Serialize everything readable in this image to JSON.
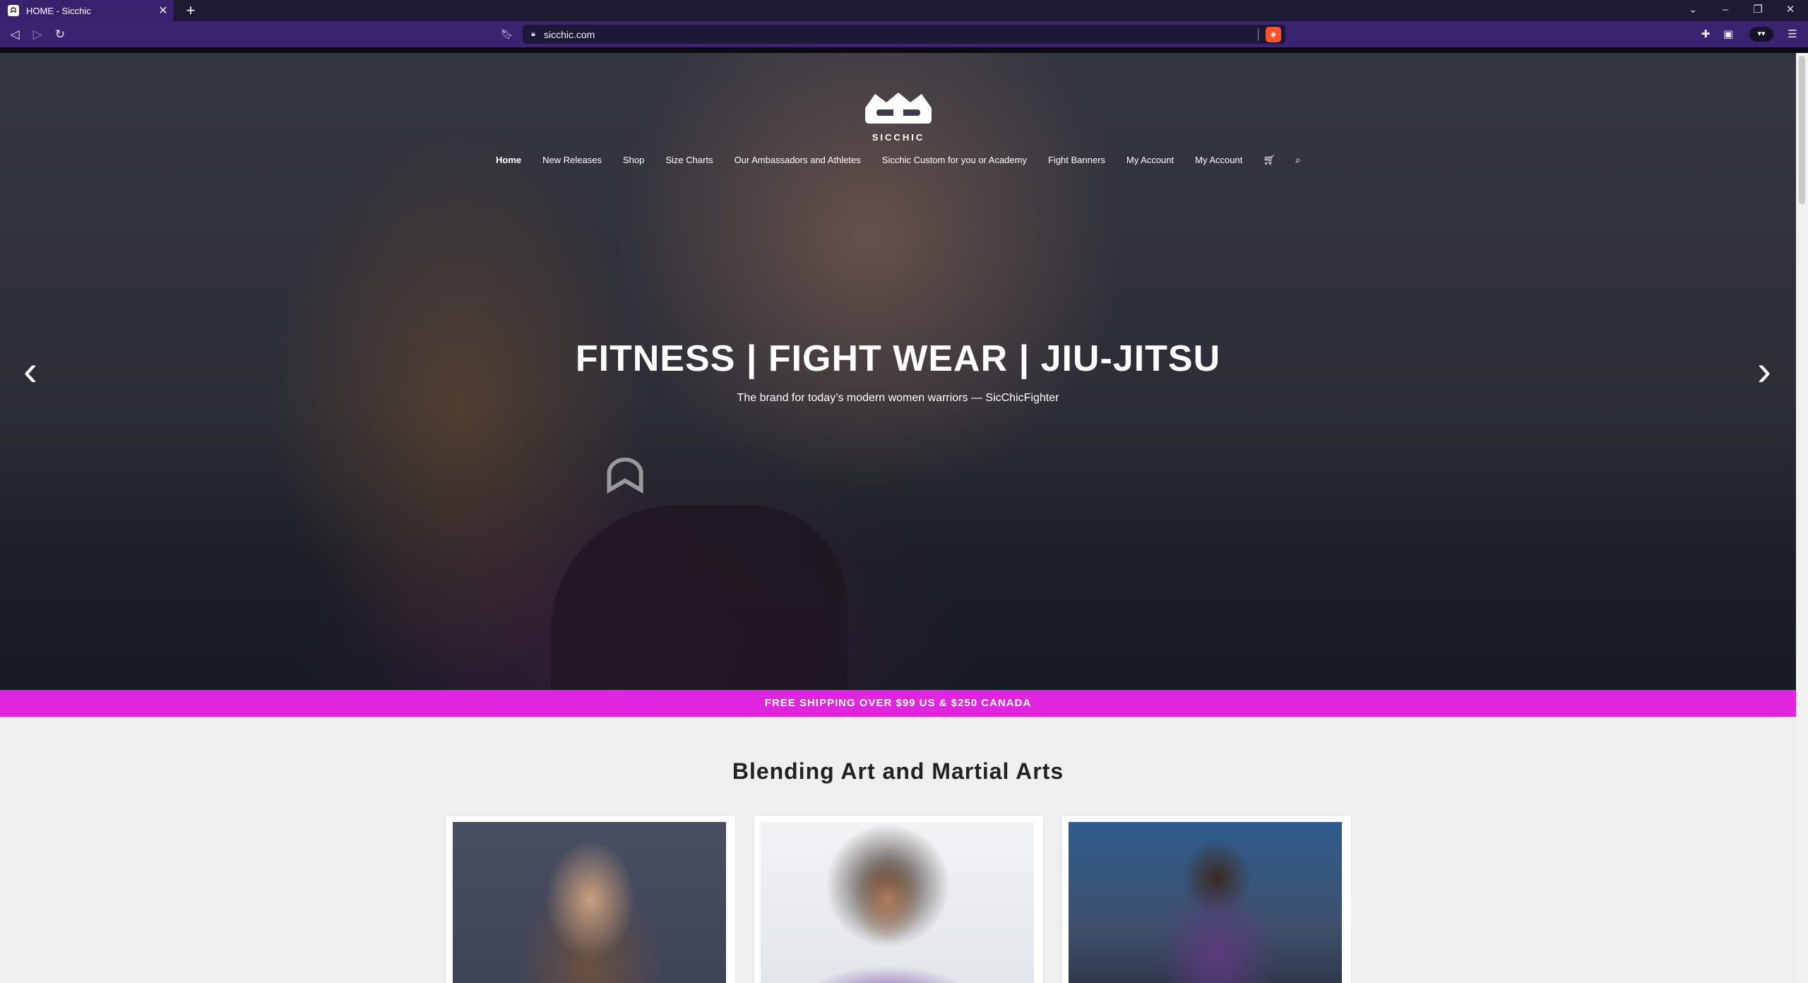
{
  "browser": {
    "tab_title": "HOME - Sicchic",
    "tab_favicon": "sicchic-favicon",
    "url": "sicchic.com"
  },
  "site": {
    "brand_name": "SICCHIC",
    "nav": [
      {
        "label": "Home",
        "active": true
      },
      {
        "label": "New Releases"
      },
      {
        "label": "Shop"
      },
      {
        "label": "Size Charts"
      },
      {
        "label": "Our Ambassadors and Athletes"
      },
      {
        "label": "Sicchic Custom for you or Academy"
      },
      {
        "label": "Fight Banners"
      },
      {
        "label": "My Account"
      },
      {
        "label": "My Account"
      }
    ],
    "nav_icons": [
      "cart-icon",
      "search-icon"
    ]
  },
  "hero": {
    "title": "FITNESS | FIGHT WEAR | JIU-JITSU",
    "subtitle": "The brand for today’s modern women warriors — SicChicFighter"
  },
  "promo": {
    "text": "FREE SHIPPING OVER $99 US & $250 CANADA"
  },
  "section": {
    "title": "Blending Art and Martial Arts"
  },
  "colors": {
    "accent_pink": "#e025de",
    "toolbar_purple": "#3a2472"
  }
}
